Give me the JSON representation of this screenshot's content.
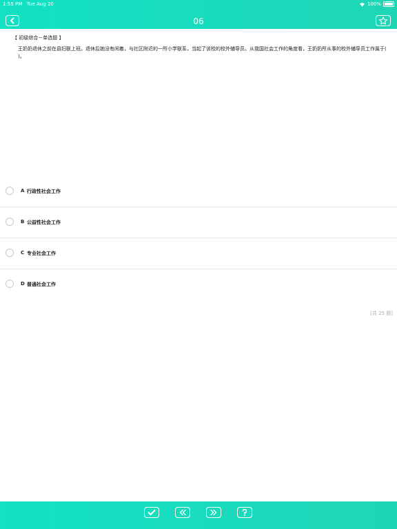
{
  "status": {
    "time": "1:55 PM",
    "date": "Tue Aug 20",
    "battery": "100%"
  },
  "nav": {
    "title": "06",
    "back_icon": "chevron-left-icon",
    "favorite_icon": "star-icon"
  },
  "question": {
    "type": "【 初级综合－单选题 】",
    "text": "王奶奶退休之前在县妇联上班。退休后她没有闲着，与社区附近的一所小学联系，当起了该校的校外辅导员。从我国社会工作的角度看，王奶奶所从事的校外辅导员工作属于(   )。"
  },
  "options": [
    {
      "letter": "A",
      "text": "行政性社会工作"
    },
    {
      "letter": "B",
      "text": "公益性社会工作"
    },
    {
      "letter": "C",
      "text": "专业社会工作"
    },
    {
      "letter": "D",
      "text": "普通社会工作"
    }
  ],
  "total": "[共 25 题]",
  "toolbar": {
    "check_icon": "check-icon",
    "prev_icon": "double-chevron-left-icon",
    "next_icon": "double-chevron-right-icon",
    "help_icon": "question-icon"
  },
  "colors": {
    "accent": "#14dcc0"
  }
}
